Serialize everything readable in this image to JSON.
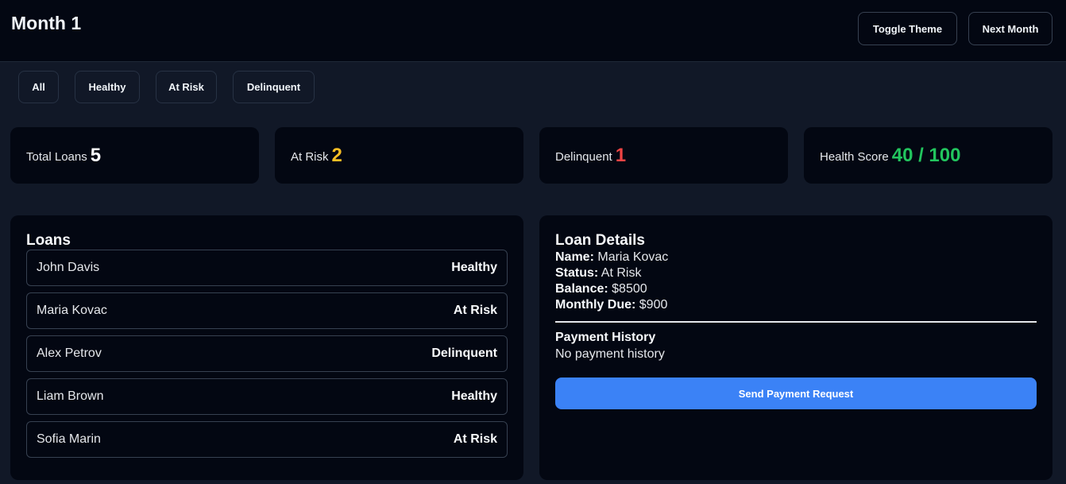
{
  "header": {
    "title": "Month 1",
    "toggle_theme_label": "Toggle Theme",
    "next_month_label": "Next Month"
  },
  "filters": [
    "All",
    "Healthy",
    "At Risk",
    "Delinquent"
  ],
  "stats": {
    "total_loans": {
      "label": "Total Loans",
      "value": "5"
    },
    "at_risk": {
      "label": "At Risk",
      "value": "2"
    },
    "delinquent": {
      "label": "Delinquent",
      "value": "1"
    },
    "health_score": {
      "label": "Health Score",
      "value": "40 / 100"
    }
  },
  "loans": {
    "title": "Loans",
    "items": [
      {
        "name": "John Davis",
        "status": "Healthy"
      },
      {
        "name": "Maria Kovac",
        "status": "At Risk"
      },
      {
        "name": "Alex Petrov",
        "status": "Delinquent"
      },
      {
        "name": "Liam Brown",
        "status": "Healthy"
      },
      {
        "name": "Sofia Marin",
        "status": "At Risk"
      }
    ]
  },
  "details": {
    "title": "Loan Details",
    "name_label": "Name:",
    "name": "Maria Kovac",
    "status_label": "Status:",
    "status": "At Risk",
    "balance_label": "Balance:",
    "balance": "$8500",
    "monthly_due_label": "Monthly Due:",
    "monthly_due": "$900",
    "payment_history_title": "Payment History",
    "payment_history_empty": "No payment history",
    "send_button_label": "Send Payment Request"
  },
  "colors": {
    "at_risk": "#fbbf24",
    "delinquent": "#ef4444",
    "health": "#22c55e",
    "accent": "#3b82f6"
  }
}
